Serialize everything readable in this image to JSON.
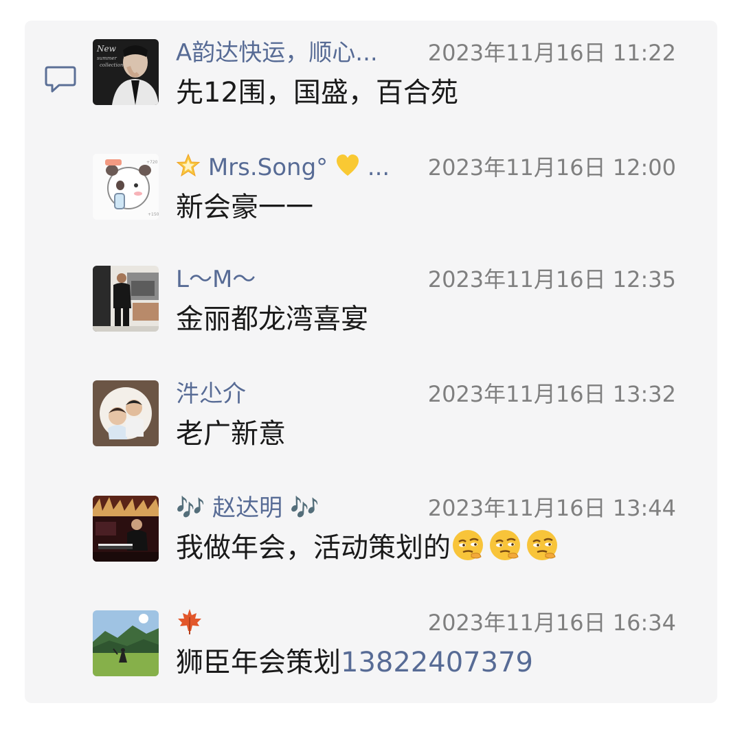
{
  "comments": [
    {
      "name": "A韵达快运，顺心...",
      "time": "2023年11月16日 11:22",
      "text": "先12围，国盛，百合苑",
      "avatar": "avatar-man-in-suit-dark"
    },
    {
      "name_prefix_icon": "star-emoji-icon",
      "name": "Mrs.Song°",
      "name_suffix": "...",
      "name_suffix_icon": "yellow-heart-emoji-icon",
      "time": "2023年11月16日 12:00",
      "text": "新会豪一一",
      "avatar": "avatar-cartoon-panda"
    },
    {
      "name": "L～M～",
      "time": "2023年11月16日 12:35",
      "text": "金丽都龙湾喜宴",
      "avatar": "avatar-man-standing-indoors"
    },
    {
      "name": "汼尐介",
      "time": "2023年11月16日 13:32",
      "text": "老广新意",
      "avatar": "avatar-children-circle-photo"
    },
    {
      "name_prefix": "🎶",
      "name": "赵达明",
      "name_suffix": "🎶",
      "time": "2023年11月16日 13:44",
      "text": "我做年会，活动策划的",
      "text_emoji": [
        "thinking-face-emoji-icon",
        "thinking-face-emoji-icon",
        "thinking-face-emoji-icon"
      ],
      "avatar": "avatar-man-at-piano-stage"
    },
    {
      "name_icon": "maple-leaf-emoji-icon",
      "time": "2023年11月16日 16:34",
      "text": "狮臣年会策划",
      "text_link": "13822407379",
      "avatar": "avatar-mountain-landscape"
    }
  ],
  "colors": {
    "name": "#576b95",
    "time": "#7f7f7f",
    "text": "#1a1a1a",
    "panel": "#f5f5f6"
  }
}
